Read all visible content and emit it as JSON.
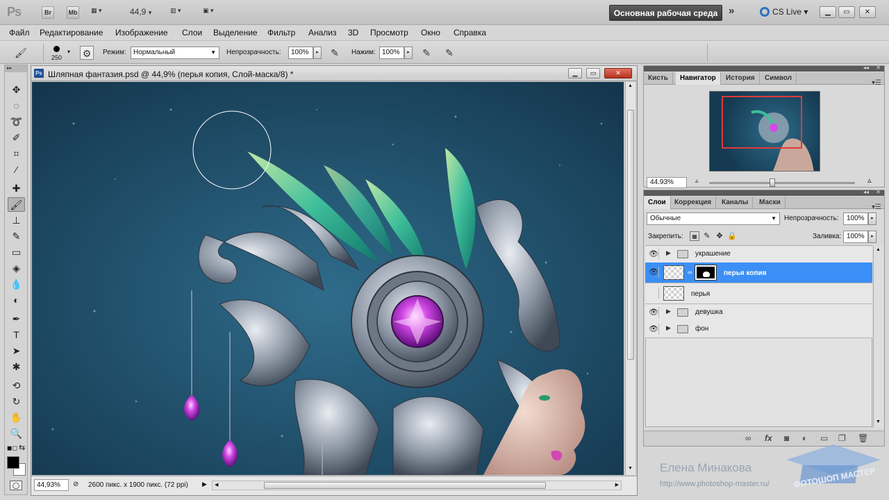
{
  "app": {
    "logo": "Ps",
    "bridge": "Br",
    "minibridge": "Mb",
    "zoom": "44,9",
    "workspace": "Основная рабочая среда",
    "cslive": "CS Live"
  },
  "menu": [
    "Файл",
    "Редактирование",
    "Изображение",
    "Слои",
    "Выделение",
    "Фильтр",
    "Анализ",
    "3D",
    "Просмотр",
    "Окно",
    "Справка"
  ],
  "options": {
    "brush_size": "250",
    "mode_label": "Режим:",
    "mode_value": "Нормальный",
    "opacity_label": "Непрозрачность:",
    "opacity_value": "100%",
    "flow_label": "Нажим:",
    "flow_value": "100%"
  },
  "document": {
    "title": "Шляпная фантазия.psd @ 44,9% (перья копия, Слой-маска/8) *",
    "status_zoom": "44,93%",
    "status_info": "2600 пикс. x 1900 пикс. (72 ppi)"
  },
  "navigator": {
    "tabs": [
      "Кисть",
      "Навигатор",
      "История",
      "Символ"
    ],
    "active_tab": "Навигатор",
    "zoom": "44.93%"
  },
  "layers": {
    "tabs": [
      "Слои",
      "Коррекция",
      "Каналы",
      "Маски"
    ],
    "active_tab": "Слои",
    "blend_mode": "Обычные",
    "opacity_label": "Непрозрачность:",
    "opacity_value": "100%",
    "lock_label": "Закрепить:",
    "fill_label": "Заливка:",
    "fill_value": "100%",
    "rows": [
      {
        "name": "украшение",
        "type": "group",
        "visible": true,
        "selected": false
      },
      {
        "name": "перья копия",
        "type": "layer-mask",
        "visible": true,
        "selected": true
      },
      {
        "name": "перья",
        "type": "layer",
        "visible": false,
        "selected": false
      },
      {
        "name": "девушка",
        "type": "group",
        "visible": true,
        "selected": false
      },
      {
        "name": "фон",
        "type": "group",
        "visible": true,
        "selected": false
      }
    ]
  },
  "watermark": {
    "author": "Елена Минакова",
    "url": "http://www.photoshop-master.ru/",
    "logo_text": "ФОТОШОП МАСТЕР"
  },
  "colors": {
    "accent_selected": "#3c8ff6",
    "canvas_bg": "#1b4660",
    "jewel": "#c23ad8"
  }
}
